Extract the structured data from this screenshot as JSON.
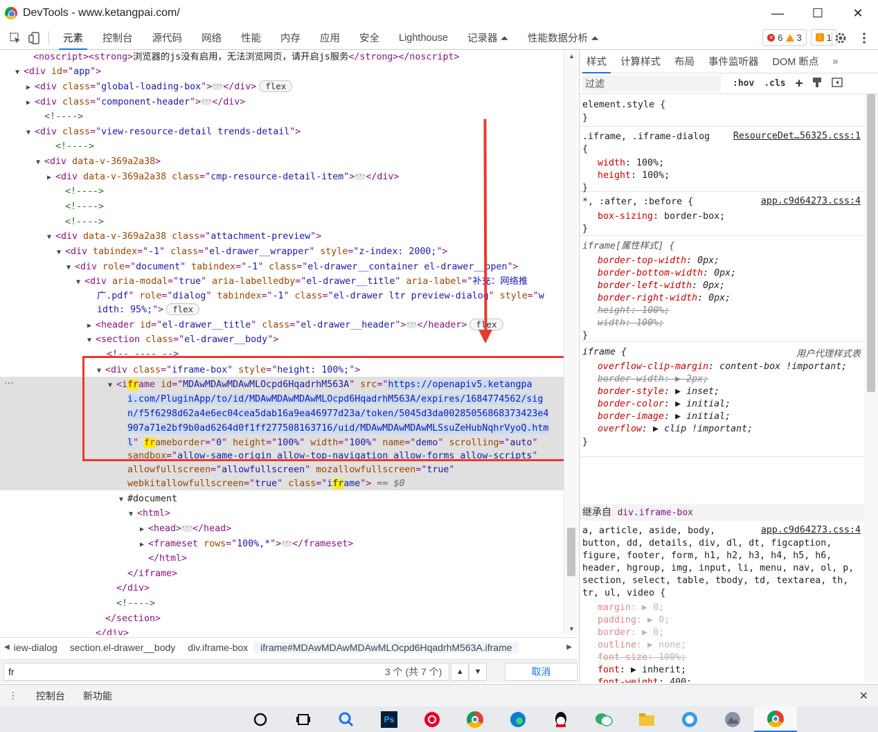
{
  "window": {
    "title": "DevTools - www.ketangpai.com/",
    "minimize": "—",
    "maximize": "☐",
    "close": "✕"
  },
  "tabs": [
    "元素",
    "控制台",
    "源代码",
    "网络",
    "性能",
    "内存",
    "应用",
    "安全",
    "Lighthouse",
    "记录器 ⏶",
    "性能数据分析 ⏶"
  ],
  "counters": {
    "errors": "6",
    "warnings": "3",
    "issues": "1"
  },
  "dom": [
    {
      "indent": 48,
      "tri": "",
      "html": "<span class='tag'>&lt;noscript&gt;&lt;strong&gt;</span><span class='txt'>浏览器的js没有启用，无法浏览网页，请开启js服务</span><span class='tag'>&lt;/strong&gt;&lt;/noscript&gt;</span>"
    },
    {
      "indent": 36,
      "tri": "▼",
      "html": "<span class='tag'>&lt;div </span><span class='attr'>id</span><span class='tag'>=\"</span><span class='val'>app</span><span class='tag'>\"&gt;</span>"
    },
    {
      "indent": 52,
      "tri": "▶",
      "html": "<span class='tag'>&lt;div </span><span class='attr'>class</span><span class='tag'>=\"</span><span class='val'>global-loading-box</span><span class='tag'>\"&gt;</span><span class='ell'>···</span><span class='tag'>&lt;/div&gt;</span><span class='badge'>flex</span>"
    },
    {
      "indent": 52,
      "tri": "▶",
      "html": "<span class='tag'>&lt;div </span><span class='attr'>class</span><span class='tag'>=\"</span><span class='val'>component-header</span><span class='tag'>\"&gt;</span><span class='ell'>···</span><span class='tag'>&lt;/div&gt;</span>"
    },
    {
      "indent": 64,
      "tri": "",
      "html": "<span class='cmt'>&lt;!----&gt;</span>"
    },
    {
      "indent": 52,
      "tri": "▼",
      "html": "<span class='tag'>&lt;div </span><span class='attr'>class</span><span class='tag'>=\"</span><span class='val'>view-resource-detail trends-detail</span><span class='tag'>\"&gt;</span>"
    },
    {
      "indent": 80,
      "tri": "",
      "html": "<span class='cmt'>&lt;!----&gt;</span>"
    },
    {
      "indent": 66,
      "tri": "▼",
      "html": "<span class='tag'>&lt;div </span><span class='attr'>data-v-369a2a38</span><span class='tag'>&gt;</span>"
    },
    {
      "indent": 82,
      "tri": "▶",
      "html": "<span class='tag'>&lt;div </span><span class='attr'>data-v-369a2a38</span> <span class='attr'>class</span><span class='tag'>=\"</span><span class='val'>cmp-resource-detail-item</span><span class='tag'>\"&gt;</span><span class='ell'>···</span><span class='tag'>&lt;/div&gt;</span>"
    },
    {
      "indent": 94,
      "tri": "",
      "html": "<span class='cmt'>&lt;!----&gt;</span>"
    },
    {
      "indent": 94,
      "tri": "",
      "html": "<span class='cmt'>&lt;!----&gt;</span>"
    },
    {
      "indent": 94,
      "tri": "",
      "html": "<span class='cmt'>&lt;!----&gt;</span>"
    },
    {
      "indent": 82,
      "tri": "▼",
      "html": "<span class='tag'>&lt;div </span><span class='attr'>data-v-369a2a38</span> <span class='attr'>class</span><span class='tag'>=\"</span><span class='val'>attachment-preview</span><span class='tag'>\"&gt;</span>"
    },
    {
      "indent": 96,
      "tri": "▼",
      "html": "<span class='tag'>&lt;div </span><span class='attr'>tabindex</span><span class='tag'>=\"</span><span class='val'>-1</span><span class='tag'>\" </span><span class='attr'>class</span><span class='tag'>=\"</span><span class='val'>el-drawer__wrapper</span><span class='tag'>\" </span><span class='attr'>style</span><span class='tag'>=\"</span><span class='val'>z-index: 2000;</span><span class='tag'>\"&gt;</span>"
    },
    {
      "indent": 110,
      "tri": "▼",
      "html": "<span class='tag'>&lt;div </span><span class='attr'>role</span><span class='tag'>=\"</span><span class='val'>document</span><span class='tag'>\" </span><span class='attr'>tabindex</span><span class='tag'>=\"</span><span class='val'>-1</span><span class='tag'>\" </span><span class='attr'>class</span><span class='tag'>=\"</span><span class='val'>el-drawer__container el-drawer__open</span><span class='tag'>\"&gt;</span>"
    },
    {
      "indent": 124,
      "tri": "▼",
      "html": "<span class='tag'>&lt;div </span><span class='attr'>aria-modal</span><span class='tag'>=\"</span><span class='val'>true</span><span class='tag'>\" </span><span class='attr'>aria-labelledby</span><span class='tag'>=\"</span><span class='val'>el-drawer__title</span><span class='tag'>\" </span><span class='attr'>aria-label</span><span class='tag'>=\"</span><span class='val'>补充：网络推</span>"
    },
    {
      "indent": 140,
      "tri": "",
      "html": "<span class='val'>广.pdf</span><span class='tag'>\" </span><span class='attr'>role</span><span class='tag'>=\"</span><span class='val'>dialog</span><span class='tag'>\" </span><span class='attr'>tabindex</span><span class='tag'>=\"</span><span class='val'>-1</span><span class='tag'>\" </span><span class='attr'>class</span><span class='tag'>=\"</span><span class='val'>el-drawer ltr preview-dialog</span><span class='tag'>\" </span><span class='attr'>style</span><span class='tag'>=\"</span><span class='val'>w</span>"
    },
    {
      "indent": 140,
      "tri": "",
      "html": "<span class='val'>idth: 95%;</span><span class='tag'>\"&gt;</span><span class='badge'>flex</span>"
    },
    {
      "indent": 140,
      "tri": "▶",
      "html": "<span class='tag'>&lt;header </span><span class='attr'>id</span><span class='tag'>=\"</span><span class='val'>el-drawer__title</span><span class='tag'>\" </span><span class='attr'>class</span><span class='tag'>=\"</span><span class='val'>el-drawer__header</span><span class='tag'>\"&gt;</span><span class='ell'>···</span><span class='tag'>&lt;/header&gt;</span><span class='badge'>flex</span>"
    },
    {
      "indent": 140,
      "tri": "▼",
      "html": "<span class='tag'>&lt;section </span><span class='attr'>class</span><span class='tag'>=\"</span><span class='val'>el-drawer__body</span><span class='tag'>\"&gt;</span>"
    },
    {
      "indent": 154,
      "tri": "",
      "html": "<span class='tag'>&lt;!-- ---- --&gt;</span>"
    },
    {
      "indent": 154,
      "tri": "▼",
      "html": "<span class='tag'>&lt;div </span><span class='attr'>class</span><span class='tag'>=\"</span><span class='val'>iframe-box</span><span class='tag'>\" </span><span class='attr'>style</span><span class='tag'>=\"</span><span class='val'>height: 100%;</span><span class='tag'>\"&gt;</span>"
    },
    {
      "indent": 170,
      "tri": "▼",
      "html": "<span class='tag'>&lt;i<span class='hl'>fr</span>ame </span><span class='attr'>id</span><span class='tag'>=\"</span><span class='val'>MDAwMDAwMDAwMLOcpd6HqadrhM563A</span><span class='tag'>\"</span> <span class='attr'>src</span><span class='tag'>=\"</span><span class='val urlsel'>https://openapiv5.ketangpa</span>"
    },
    {
      "indent": 184,
      "tri": "",
      "html": "<span class='val urlsel'>i.com/PluginApp/to/id/MDAwMDAwMDAwMLOcpd6HqadrhM563A/expires/1684774562/sig</span>"
    },
    {
      "indent": 184,
      "tri": "",
      "html": "<span class='val urlsel'>n/f5f6298d62a4e6ec04cea5dab16a9ea46977d23a/token/5045d3da00285056868373423e4</span>"
    },
    {
      "indent": 184,
      "tri": "",
      "html": "<span class='val urlsel'>907a71e2bf9b0ad6264d0f1ff277508163716/uid/MDAwMDAwMDAwMLSsuZeHubNqhrVyoQ.htm</span>"
    },
    {
      "indent": 184,
      "tri": "",
      "html": "<span class='val urlsel'>l</span><span class='tag'>\" </span><span class='attr'><span class='hl'>fr</span>ameborder</span><span class='tag'>=\"</span><span class='val'>0</span><span class='tag'>\" </span><span class='attr'>height</span><span class='tag'>=\"</span><span class='val'>100%</span><span class='tag'>\" </span><span class='attr'>width</span><span class='tag'>=\"</span><span class='val'>100%</span><span class='tag'>\" </span><span class='attr'>name</span><span class='tag'>=\"</span><span class='val'>demo</span><span class='tag'>\" </span><span class='attr'>scrolling</span><span class='tag'>=\"</span><span class='val'>auto</span><span class='tag'>\"</span>"
    },
    {
      "indent": 184,
      "tri": "",
      "html": "<span class='attr'>sandbox</span><span class='tag'>=\"</span><span class='val'>allow-same-origin allow-top-navigation allow-forms allow-scripts</span><span class='tag'>\"</span>"
    },
    {
      "indent": 184,
      "tri": "",
      "html": "<span class='attr'>allowfullscreen</span><span class='tag'>=\"</span><span class='val'>allowfullscreen</span><span class='tag'>\" </span><span class='attr'>mozallowfullscreen</span><span class='tag'>=\"</span><span class='val'>true</span><span class='tag'>\"</span>"
    },
    {
      "indent": 184,
      "tri": "",
      "html": "<span class='attr'>webkitallowfullscreen</span><span class='tag'>=\"</span><span class='val'>true</span><span class='tag'>\" </span><span class='attr'>class</span><span class='tag'>=\"</span><span class='val'>i<span class='hl'>fr</span>ame</span><span class='tag'>\"&gt;</span> <span style='color:#666;font-style:italic'>== $0</span>"
    },
    {
      "indent": 186,
      "tri": "▼",
      "html": "<span class='txt'>#document</span>"
    },
    {
      "indent": 200,
      "tri": "▼",
      "html": "<span class='tag'>&lt;html&gt;</span>"
    },
    {
      "indent": 216,
      "tri": "▶",
      "html": "<span class='tag'>&lt;head&gt;</span><span class='ell'>···</span><span class='tag'>&lt;/head&gt;</span>"
    },
    {
      "indent": 216,
      "tri": "▶",
      "html": "<span class='tag'>&lt;frameset </span><span class='attr'>rows</span><span class='tag'>=\"</span><span class='val'>100%,*</span><span class='tag'>\"&gt;</span><span class='ell'>···</span><span class='tag'>&lt;/frameset&gt;</span>"
    },
    {
      "indent": 214,
      "tri": "",
      "html": "<span class='tag'>&lt;/html&gt;</span>"
    },
    {
      "indent": 184,
      "tri": "",
      "html": "<span class='tag'>&lt;/iframe&gt;</span>"
    },
    {
      "indent": 168,
      "tri": "",
      "html": "<span class='tag'>&lt;/div&gt;</span>"
    },
    {
      "indent": 168,
      "tri": "",
      "html": "<span class='cmt'>&lt;!----&gt;</span>"
    },
    {
      "indent": 152,
      "tri": "",
      "html": "<span class='tag'>&lt;/section&gt;</span>"
    },
    {
      "indent": 138,
      "tri": "",
      "html": "<span class='tag'>&lt;/div&gt;</span>"
    }
  ],
  "breadcrumb": [
    "iew-dialog",
    "section.el-drawer__body",
    "div.iframe-box",
    "iframe#MDAwMDAwMDAwMLOcpd6HqadrhM563A.iframe"
  ],
  "search": {
    "value": "fr",
    "count": "3 个 (共 7 个)",
    "cancel": "取消"
  },
  "styles_tabs": [
    "样式",
    "计算样式",
    "布局",
    "事件监听器",
    "DOM 断点"
  ],
  "filter": {
    "placeholder": "过滤",
    "hov": ":hov",
    "cls": ".cls"
  },
  "rules": {
    "element_style": "element.style {",
    "iframe_sel": ".iframe, .iframe-dialog",
    "iframe_src": "ResourceDet…56325.css:1",
    "after_sel": "*, :after, :before {",
    "after_src": "app.c9d64273.css:4",
    "attr_sel": "iframe[属性样式] {",
    "ua_sel": "iframe {",
    "ua_src": "用户代理样式表",
    "inherited": "继承自",
    "inherited_from": "div.iframe-box",
    "inh_src": "app.c9d64273.css:4"
  },
  "drawer": {
    "console": "控制台",
    "whatsnew": "新功能"
  }
}
